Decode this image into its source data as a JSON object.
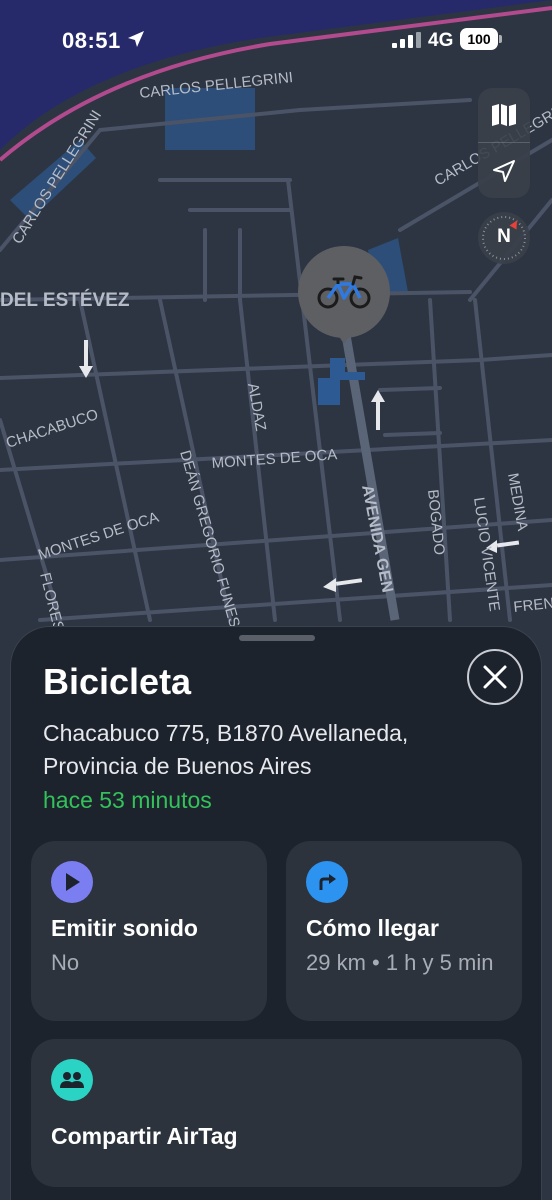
{
  "status_bar": {
    "time": "08:51",
    "network": "4G",
    "battery": "100"
  },
  "map": {
    "street_labels": [
      "CARLOS PELLEGRINI",
      "CARLOS PELLEGRINI",
      "CARLOS PELLEGRINI",
      "DEL ESTÉVEZ",
      "CHACABUCO",
      "ALDAZ",
      "MONTES DE OCA",
      "MONTES DE OCA",
      "DEÁN GREGORIO FUNES",
      "AVENIDA GEN",
      "BOGADO",
      "LUCIO VICENTE",
      "MEDINA",
      "FLORES",
      "FREN"
    ],
    "compass_label": "N",
    "marker_icon": "bicycle-icon"
  },
  "sheet": {
    "title": "Bicicleta",
    "address": "Chacabuco 775, B1870 Avellaneda, Provincia de Buenos Aires",
    "last_seen": "hace 53 minutos",
    "actions": [
      {
        "title": "Emitir sonido",
        "subtitle": "No",
        "icon": "play-icon",
        "color": "#7b7ef0"
      },
      {
        "title": "Cómo llegar",
        "subtitle": "29 km • 1 h y 5 min",
        "icon": "directions-icon",
        "color": "#2d93f0"
      },
      {
        "title": "Compartir AirTag",
        "icon": "people-icon",
        "color": "#2bd3c4"
      }
    ]
  }
}
